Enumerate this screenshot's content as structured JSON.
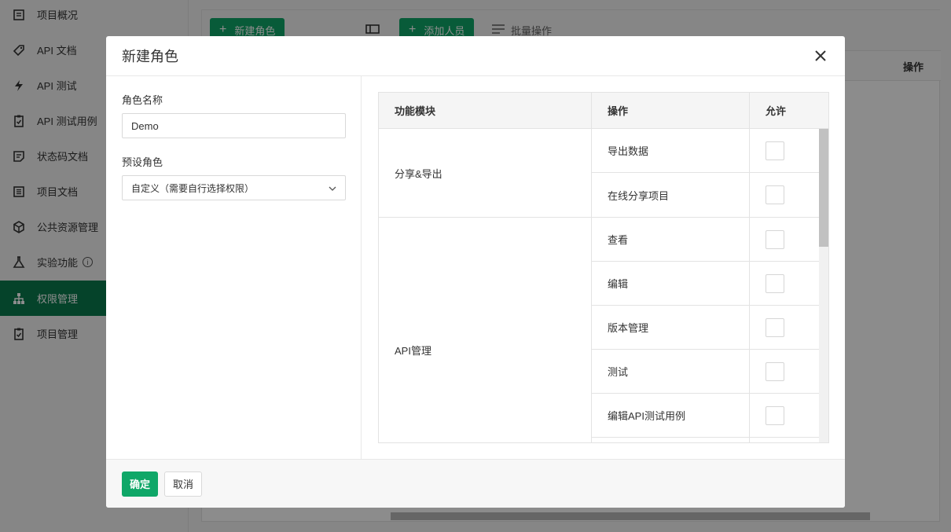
{
  "sidebar": {
    "items": [
      {
        "label": "项目概况",
        "icon": "overview-icon"
      },
      {
        "label": "API 文档",
        "icon": "tag-icon"
      },
      {
        "label": "API 测试",
        "icon": "lightning-icon"
      },
      {
        "label": "API 测试用例",
        "icon": "clipboard-check-icon"
      },
      {
        "label": "状态码文档",
        "icon": "document-icon"
      },
      {
        "label": "项目文档",
        "icon": "list-document-icon"
      },
      {
        "label": "公共资源管理",
        "icon": "cube-icon"
      },
      {
        "label": "实验功能",
        "icon": "flask-icon",
        "badge": "i"
      },
      {
        "label": "权限管理",
        "icon": "sitemap-icon",
        "active": true
      },
      {
        "label": "项目管理",
        "icon": "clipboard-check-icon"
      }
    ]
  },
  "main": {
    "new_role_button": "新建角色",
    "add_member_button": "添加人员",
    "batch_label": "批量操作",
    "column_operation": "操作"
  },
  "modal": {
    "title": "新建角色",
    "role_name_label": "角色名称",
    "role_name_value": "Demo",
    "preset_role_label": "预设角色",
    "preset_role_value": "自定义（需要自行选择权限）",
    "table_headers": {
      "module": "功能模块",
      "action": "操作",
      "allow": "允许"
    },
    "groups": [
      {
        "module": "分享&导出",
        "actions": [
          "导出数据",
          "在线分享项目"
        ]
      },
      {
        "module": "API管理",
        "actions": [
          "查看",
          "编辑",
          "版本管理",
          "测试",
          "编辑API测试用例",
          ""
        ]
      }
    ],
    "confirm_button": "确定",
    "cancel_button": "取消"
  },
  "colors": {
    "accent": "#0fa768",
    "sidebar_active": "#0a7a4e"
  }
}
